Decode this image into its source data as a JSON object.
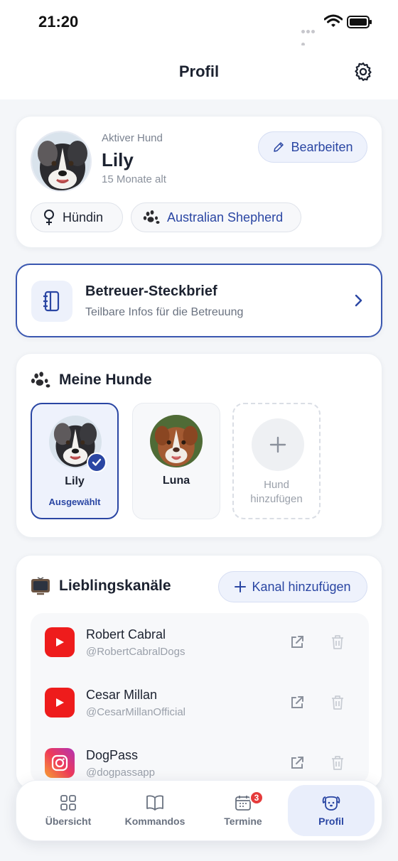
{
  "status_bar": {
    "time": "21:20"
  },
  "header": {
    "title": "Profil",
    "settings_icon": "gear-icon"
  },
  "profile": {
    "active_label": "Aktiver Hund",
    "name": "Lily",
    "age": "15 Monate alt",
    "edit_label": "Bearbeiten",
    "gender": "Hündin",
    "breed": "Australian Shepherd"
  },
  "steckbrief": {
    "title": "Betreuer-Steckbrief",
    "subtitle": "Teilbare Infos für die Betreuung"
  },
  "dogs": {
    "title": "Meine Hunde",
    "items": [
      {
        "name": "Lily",
        "status": "Ausgewählt",
        "selected": true
      },
      {
        "name": "Luna",
        "status": "",
        "selected": false
      }
    ],
    "add_line1": "Hund",
    "add_line2": "hinzufügen"
  },
  "channels": {
    "title": "Lieblingskanäle",
    "add_label": "Kanal hinzufügen",
    "items": [
      {
        "name": "Robert Cabral",
        "handle": "@RobertCabralDogs",
        "platform": "youtube"
      },
      {
        "name": "Cesar Millan",
        "handle": "@CesarMillanOfficial",
        "platform": "youtube"
      },
      {
        "name": "DogPass",
        "handle": "@dogpassapp",
        "platform": "instagram"
      }
    ]
  },
  "nav": {
    "items": [
      {
        "label": "Übersicht",
        "icon": "grid-icon"
      },
      {
        "label": "Kommandos",
        "icon": "book-icon"
      },
      {
        "label": "Termine",
        "icon": "calendar-icon",
        "badge": "3"
      },
      {
        "label": "Profil",
        "icon": "dog-face-icon",
        "active": true
      }
    ]
  },
  "colors": {
    "accent": "#2a46a3",
    "badge": "#e53b3b",
    "youtube": "#ee1c1c"
  }
}
